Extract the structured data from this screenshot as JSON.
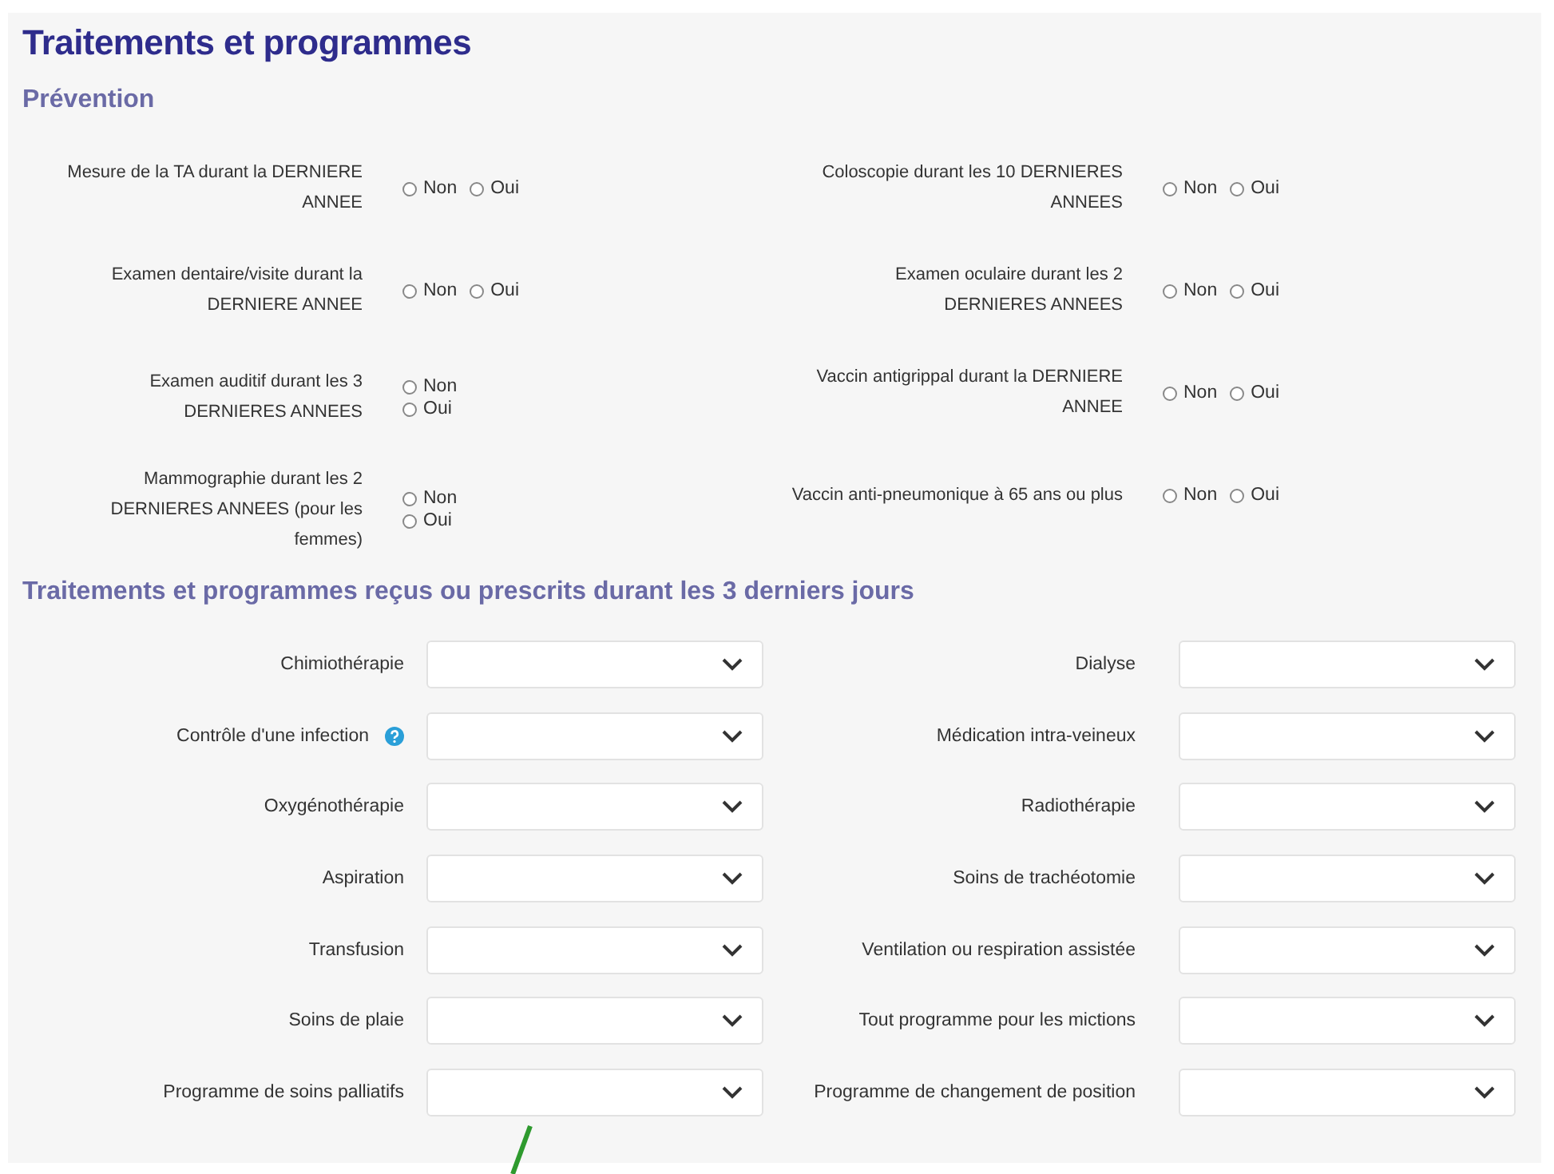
{
  "title": "Traitements et programmes",
  "prevention": {
    "heading": "Prévention",
    "items": [
      {
        "label": "Mesure de la TA durant la DERNIERE ANNEE",
        "kind": "inline",
        "options": [
          {
            "label": "Non",
            "selected": false
          },
          {
            "label": "Oui",
            "selected": false
          }
        ]
      },
      {
        "label": "Coloscopie durant les 10 DERNIERES ANNEES",
        "kind": "inline",
        "options": [
          {
            "label": "Non",
            "selected": false
          },
          {
            "label": "Oui",
            "selected": false
          }
        ]
      },
      {
        "label": "Examen dentaire/visite durant la DERNIERE ANNEE",
        "kind": "inline",
        "options": [
          {
            "label": "Non",
            "selected": false
          },
          {
            "label": "Oui",
            "selected": false
          }
        ]
      },
      {
        "label": "Examen oculaire durant les 2 DERNIERES ANNEES",
        "kind": "inline",
        "options": [
          {
            "label": "Non",
            "selected": false
          },
          {
            "label": "Oui",
            "selected": false
          }
        ]
      },
      {
        "label": "Examen auditif durant les 3 DERNIERES ANNEES",
        "kind": "stacked",
        "options": [
          {
            "label": "Non",
            "selected": false
          },
          {
            "label": "Oui",
            "selected": false
          }
        ]
      },
      {
        "label": "Vaccin antigrippal durant la DERNIERE ANNEE",
        "kind": "inline",
        "options": [
          {
            "label": "Non",
            "selected": false
          },
          {
            "label": "Oui",
            "selected": false
          }
        ]
      },
      {
        "label": "Mammographie durant les 2 DERNIERES ANNEES (pour les femmes)",
        "kind": "stacked",
        "options": [
          {
            "label": "Non",
            "selected": false
          },
          {
            "label": "Oui",
            "selected": false
          }
        ]
      },
      {
        "label": "Vaccin anti-pneumonique à 65 ans ou plus",
        "kind": "inline",
        "options": [
          {
            "label": "Non",
            "selected": false
          },
          {
            "label": "Oui",
            "selected": false
          }
        ]
      }
    ]
  },
  "treatments": {
    "heading": "Traitements et programmes reçus ou prescrits durant les 3 derniers jours",
    "items": [
      {
        "label": "Chimiothérapie",
        "help": false
      },
      {
        "label": "Dialyse",
        "help": false
      },
      {
        "label": "Contrôle d'une infection",
        "help": true
      },
      {
        "label": "Médication intra-veineux",
        "help": false
      },
      {
        "label": "Oxygénothérapie",
        "help": false
      },
      {
        "label": "Radiothérapie",
        "help": false
      },
      {
        "label": "Aspiration",
        "help": false
      },
      {
        "label": "Soins de trachéotomie",
        "help": false
      },
      {
        "label": "Transfusion",
        "help": false
      },
      {
        "label": "Ventilation ou respiration assistée",
        "help": false
      },
      {
        "label": "Soins de plaie",
        "help": false
      },
      {
        "label": "Tout programme pour les mictions",
        "help": false
      },
      {
        "label": "Programme de soins palliatifs",
        "help": false
      },
      {
        "label": "Programme de changement de position",
        "help": false
      }
    ]
  }
}
